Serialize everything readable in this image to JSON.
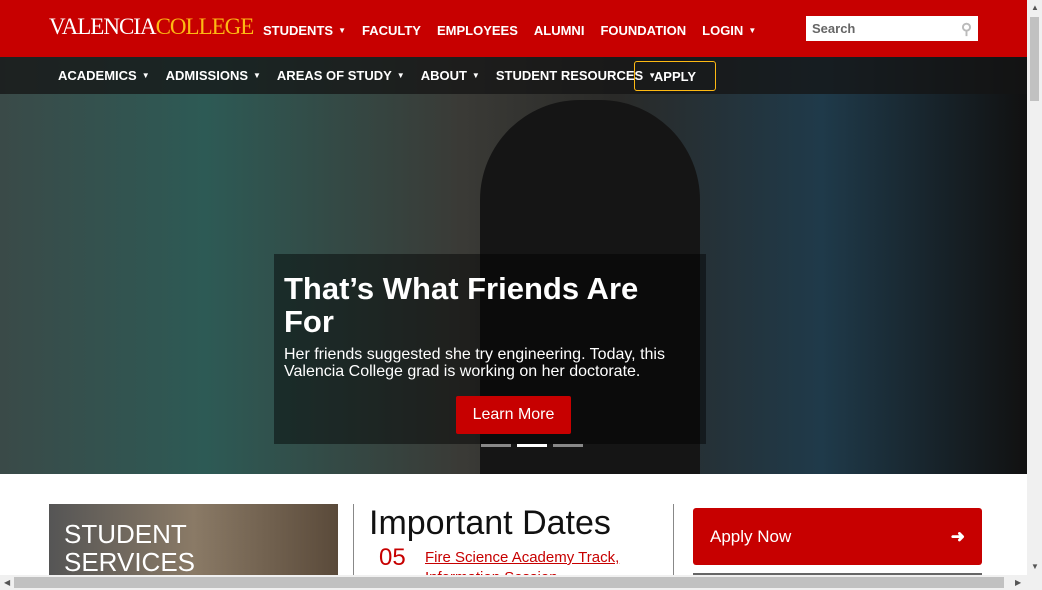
{
  "header": {
    "logo_left": "VALENCIA",
    "logo_right": "COLLEGE",
    "nav": [
      {
        "label": "STUDENTS",
        "dropdown": true
      },
      {
        "label": "FACULTY"
      },
      {
        "label": "EMPLOYEES"
      },
      {
        "label": "ALUMNI"
      },
      {
        "label": "FOUNDATION"
      },
      {
        "label": "LOGIN",
        "dropdown": true
      }
    ],
    "search_placeholder": "Search"
  },
  "subnav": [
    {
      "label": "ACADEMICS"
    },
    {
      "label": "ADMISSIONS"
    },
    {
      "label": "AREAS OF STUDY"
    },
    {
      "label": "ABOUT"
    },
    {
      "label": "STUDENT RESOURCES"
    }
  ],
  "apply_label": "APPLY",
  "hero": {
    "title": "That’s What Friends Are For",
    "text": "Her friends suggested she try engineering. Today, this Valencia College grad is working on her doctorate.",
    "button": "Learn More",
    "slides": 3,
    "active_slide": 1
  },
  "student_services": "STUDENT SERVICES",
  "dates": {
    "title": "Important Dates",
    "items": [
      {
        "day": "05",
        "label": "Fire Science Academy Track, Information Session"
      }
    ]
  },
  "apply_now": "Apply Now",
  "colors": {
    "brand": "#c70000",
    "accent": "#fdb913"
  }
}
